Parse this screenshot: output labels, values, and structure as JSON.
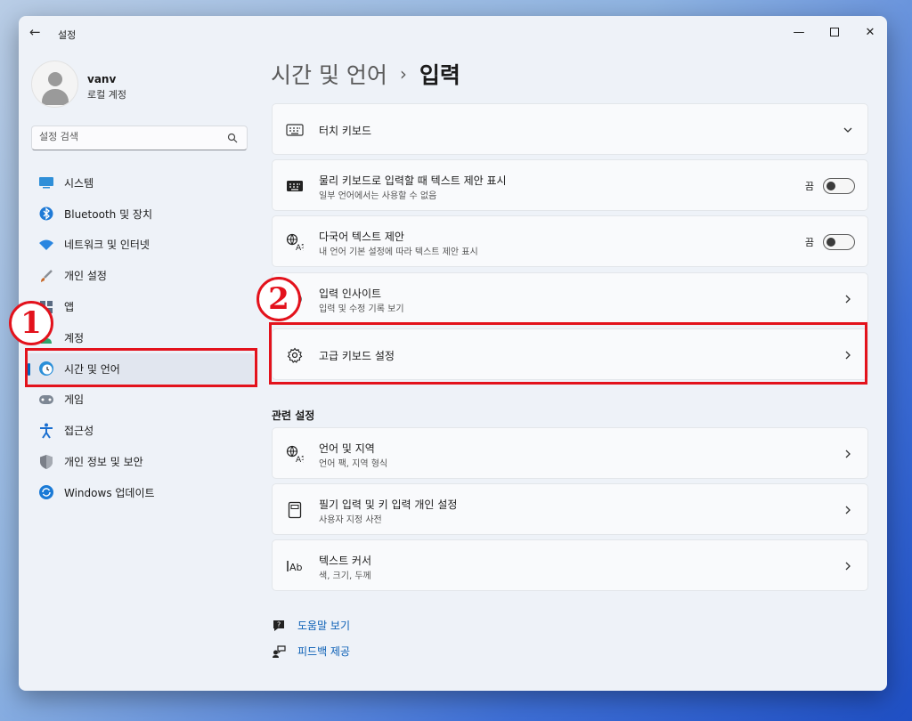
{
  "window": {
    "title": "설정"
  },
  "user": {
    "name": "vanv",
    "account_type": "로컬 계정"
  },
  "search": {
    "placeholder": "설정 검색"
  },
  "sidebar": {
    "items": [
      {
        "label": "시스템",
        "icon": "monitor-icon",
        "color": "#2f8fd8"
      },
      {
        "label": "Bluetooth 및 장치",
        "icon": "bluetooth-icon",
        "color": "#1f7ad6"
      },
      {
        "label": "네트워크 및 인터넷",
        "icon": "wifi-icon",
        "color": "#2a86e0"
      },
      {
        "label": "개인 설정",
        "icon": "brush-icon",
        "color": "#c86a2b"
      },
      {
        "label": "앱",
        "icon": "apps-icon",
        "color": "#5a6b82"
      },
      {
        "label": "계정",
        "icon": "person-icon",
        "color": "#2fa36b"
      },
      {
        "label": "시간 및 언어",
        "icon": "clock-globe-icon",
        "color": "#2a8fd8",
        "active": true
      },
      {
        "label": "게임",
        "icon": "gamepad-icon",
        "color": "#7d8794"
      },
      {
        "label": "접근성",
        "icon": "accessibility-icon",
        "color": "#1a6fd0"
      },
      {
        "label": "개인 정보 및 보안",
        "icon": "shield-icon",
        "color": "#7a7f88"
      },
      {
        "label": "Windows 업데이트",
        "icon": "update-icon",
        "color": "#1a7ad6"
      }
    ]
  },
  "breadcrumb": {
    "parent": "시간 및 언어",
    "separator": "›",
    "current": "입력"
  },
  "cards": {
    "touch_keyboard": {
      "title": "터치 키보드"
    },
    "text_suggestions": {
      "title": "물리 키보드로 입력할 때 텍스트 제안 표시",
      "subtitle": "일부 언어에서는 사용할 수 없음",
      "toggle_label": "끔",
      "toggle_on": false
    },
    "multilingual": {
      "title": "다국어 텍스트 제안",
      "subtitle": "내 언어 기본 설정에 따라 텍스트 제안 표시",
      "toggle_label": "끔",
      "toggle_on": false
    },
    "typing_insights": {
      "title": "입력 인사이트",
      "subtitle": "입력 및 수정 기록 보기"
    },
    "advanced_keyboard": {
      "title": "고급 키보드 설정"
    }
  },
  "related": {
    "title": "관련 설정",
    "items": [
      {
        "title": "언어 및 지역",
        "subtitle": "언어 팩, 지역 형식"
      },
      {
        "title": "필기 입력 및 키 입력 개인 설정",
        "subtitle": "사용자 지정 사전"
      },
      {
        "title": "텍스트 커서",
        "subtitle": "색, 크기, 두께"
      }
    ]
  },
  "links": {
    "help": "도움말 보기",
    "feedback": "피드백 제공"
  },
  "annotations": {
    "step1": "1",
    "step2": "2",
    "color": "#e3121c"
  }
}
